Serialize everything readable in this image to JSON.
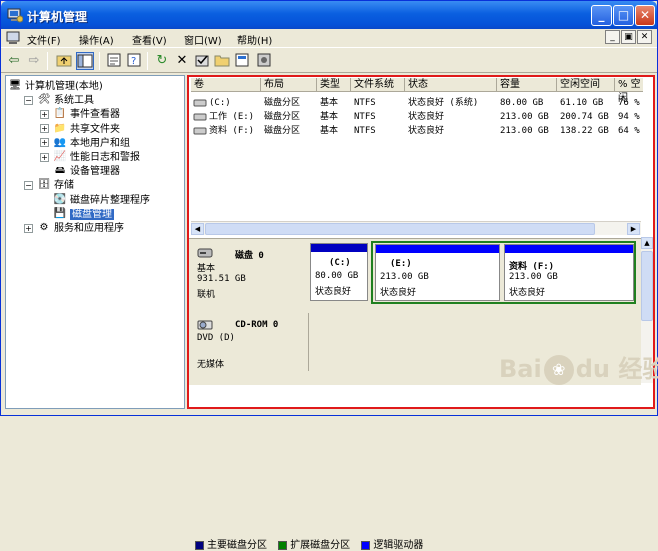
{
  "window": {
    "title": "计算机管理"
  },
  "menu": [
    "文件(F)",
    "操作(A)",
    "查看(V)",
    "窗口(W)",
    "帮助(H)"
  ],
  "tree": [
    {
      "label": "计算机管理(本地)",
      "level": 0,
      "expander": "",
      "icon": "computer"
    },
    {
      "label": "系统工具",
      "level": 1,
      "expander": "−",
      "icon": "tools"
    },
    {
      "label": "事件查看器",
      "level": 2,
      "expander": "+",
      "icon": "event"
    },
    {
      "label": "共享文件夹",
      "level": 2,
      "expander": "+",
      "icon": "folder"
    },
    {
      "label": "本地用户和组",
      "level": 2,
      "expander": "+",
      "icon": "users"
    },
    {
      "label": "性能日志和警报",
      "level": 2,
      "expander": "+",
      "icon": "perf"
    },
    {
      "label": "设备管理器",
      "level": 2,
      "expander": "",
      "icon": "device"
    },
    {
      "label": "存储",
      "level": 1,
      "expander": "−",
      "icon": "storage"
    },
    {
      "label": "磁盘碎片整理程序",
      "level": 2,
      "expander": "",
      "icon": "defrag"
    },
    {
      "label": "磁盘管理",
      "level": 2,
      "expander": "",
      "icon": "disk",
      "selected": true
    },
    {
      "label": "服务和应用程序",
      "level": 1,
      "expander": "+",
      "icon": "services"
    }
  ],
  "columns": [
    "卷",
    "布局",
    "类型",
    "文件系统",
    "状态",
    "容量",
    "空闲空间",
    "% 空闲"
  ],
  "volumes": [
    {
      "vol": "(C:)",
      "layout": "磁盘分区",
      "type": "基本",
      "fs": "NTFS",
      "status": "状态良好 (系统)",
      "cap": "80.00 GB",
      "free": "61.10 GB",
      "pct": "76 %"
    },
    {
      "vol": "工作 (E:)",
      "layout": "磁盘分区",
      "type": "基本",
      "fs": "NTFS",
      "status": "状态良好",
      "cap": "213.00 GB",
      "free": "200.74 GB",
      "pct": "94 %"
    },
    {
      "vol": "资料 (F:)",
      "layout": "磁盘分区",
      "type": "基本",
      "fs": "NTFS",
      "status": "状态良好",
      "cap": "213.00 GB",
      "free": "138.22 GB",
      "pct": "64 %"
    }
  ],
  "disk0": {
    "name": "磁盘 0",
    "kind": "基本",
    "size": "931.51 GB",
    "state": "联机"
  },
  "partitions": [
    {
      "name": "(C:)",
      "size": "80.00 GB",
      "status": "状态良好"
    },
    {
      "name": "(E:)",
      "size": "213.00 GB",
      "status": "状态良好"
    },
    {
      "name": "资料  (F:)",
      "size": "213.00 GB",
      "status": "状态良好"
    }
  ],
  "cdrom": {
    "name": "CD-ROM 0",
    "drive": "DVD (D)",
    "media": "无媒体"
  },
  "legend": [
    {
      "label": "主要磁盘分区",
      "color": "#00007f"
    },
    {
      "label": "扩展磁盘分区",
      "color": "#008000"
    },
    {
      "label": "逻辑驱动器",
      "color": "#0000ff"
    }
  ],
  "watermark": {
    "brand": "Bai",
    "brand2": "du",
    "text": "经验"
  }
}
